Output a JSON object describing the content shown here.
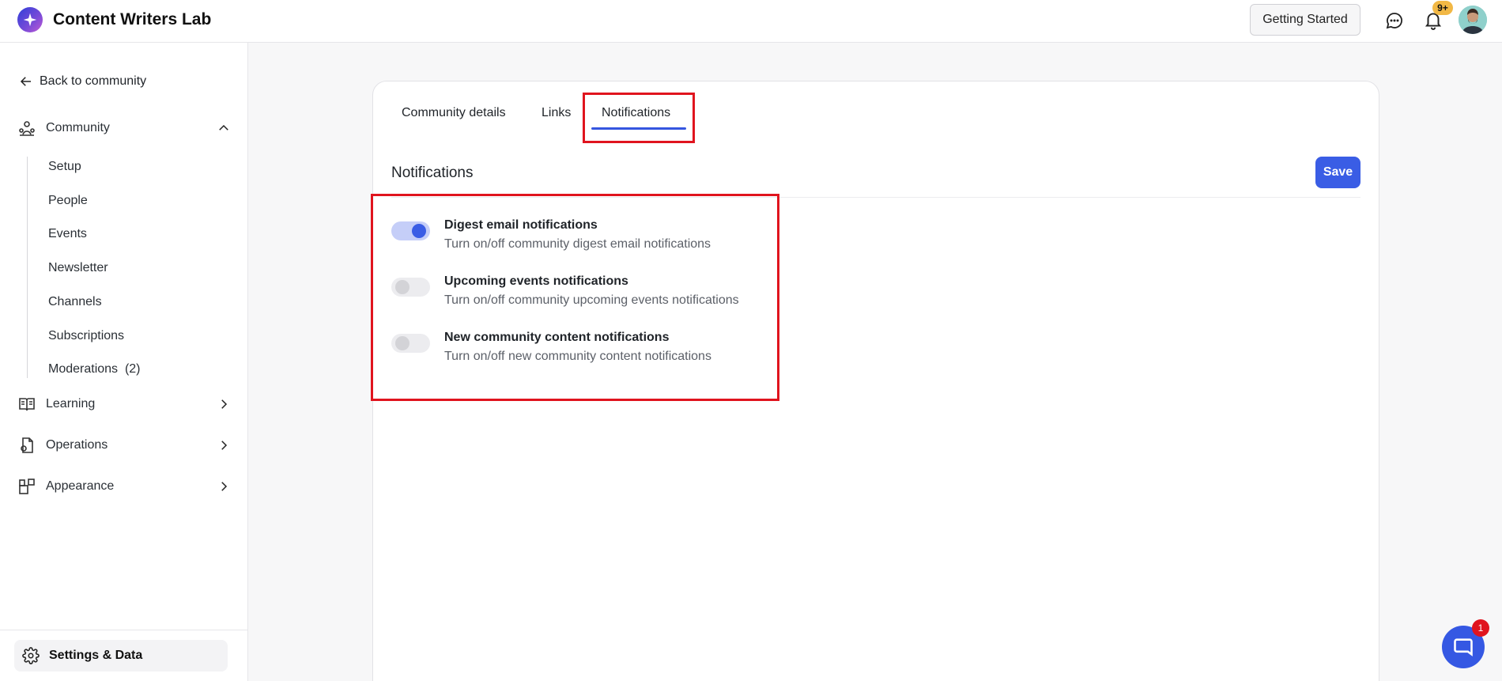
{
  "app": {
    "title": "Content Writers Lab"
  },
  "header": {
    "getting_started": "Getting Started",
    "notification_badge": "9+"
  },
  "sidebar": {
    "back_label": "Back to community",
    "groups": [
      {
        "label": "Community",
        "icon": "community-icon",
        "expanded": true
      },
      {
        "label": "Learning",
        "icon": "book-icon",
        "expanded": false
      },
      {
        "label": "Operations",
        "icon": "operations-icon",
        "expanded": false
      },
      {
        "label": "Appearance",
        "icon": "appearance-icon",
        "expanded": false
      }
    ],
    "community_items": [
      "Setup",
      "People",
      "Events",
      "Newsletter",
      "Channels",
      "Subscriptions",
      "Moderations  (2)"
    ],
    "settings_label": "Settings & Data"
  },
  "tabs": [
    "Community details",
    "Links",
    "Notifications"
  ],
  "active_tab": "Notifications",
  "section": {
    "title": "Notifications",
    "save_label": "Save"
  },
  "notifications": [
    {
      "title": "Digest email notifications",
      "description": "Turn on/off community digest email notifications",
      "enabled": true
    },
    {
      "title": "Upcoming events notifications",
      "description": "Turn on/off community upcoming events notifications",
      "enabled": false
    },
    {
      "title": "New community content notifications",
      "description": "Turn on/off new community content notifications",
      "enabled": false
    }
  ],
  "chat_widget": {
    "badge": "1"
  },
  "colors": {
    "accent": "#3a5de5",
    "highlight": "#e0141e",
    "badge": "#f2b845"
  }
}
